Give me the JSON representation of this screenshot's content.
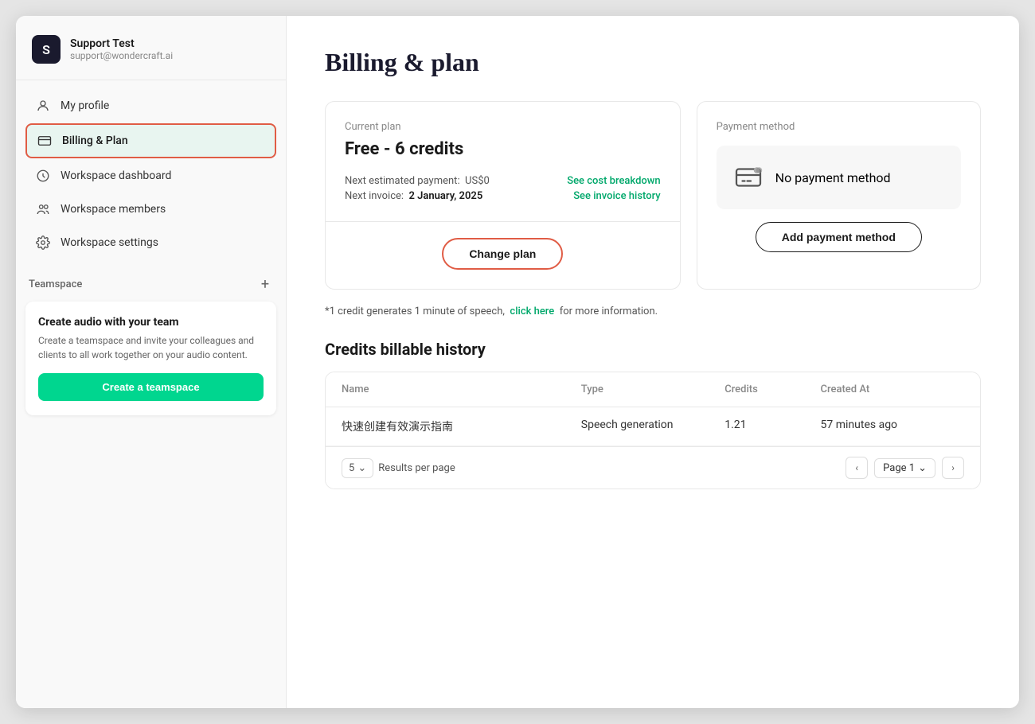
{
  "workspace": {
    "avatar_letter": "S",
    "name": "Support Test",
    "email": "support@wondercraft.ai"
  },
  "nav": {
    "my_profile_label": "My profile",
    "billing_label": "Billing & Plan",
    "workspace_dashboard_label": "Workspace dashboard",
    "workspace_members_label": "Workspace members",
    "workspace_settings_label": "Workspace settings"
  },
  "teamspace": {
    "section_label": "Teamspace",
    "add_icon": "+",
    "card_title": "Create audio with your team",
    "card_desc": "Create a teamspace and invite your colleagues and clients to all work together on your audio content.",
    "create_btn_label": "Create a teamspace"
  },
  "page_title": "Billing & plan",
  "current_plan": {
    "label": "Current plan",
    "plan_name": "Free - 6 credits",
    "next_payment_label": "Next estimated payment:",
    "next_payment_value": "US$0",
    "next_invoice_label": "Next invoice:",
    "next_invoice_value": "2 January, 2025",
    "see_cost_breakdown": "See cost breakdown",
    "see_invoice_history": "See invoice history",
    "change_plan_btn": "Change plan"
  },
  "payment_method": {
    "label": "Payment method",
    "no_payment_text": "No payment method",
    "add_payment_btn": "Add payment method"
  },
  "credit_info": {
    "text_before_link": "*1 credit generates 1 minute of speech,",
    "link_text": "click here",
    "text_after_link": "for more information."
  },
  "history": {
    "section_title": "Credits billable history",
    "columns": [
      "Name",
      "Type",
      "Credits",
      "Created At"
    ],
    "rows": [
      {
        "name": "快速创建有效演示指南",
        "type": "Speech generation",
        "credits": "1.21",
        "created_at": "57 minutes ago"
      }
    ],
    "per_page": "5",
    "per_page_label": "Results per page",
    "page_label": "Page 1"
  }
}
